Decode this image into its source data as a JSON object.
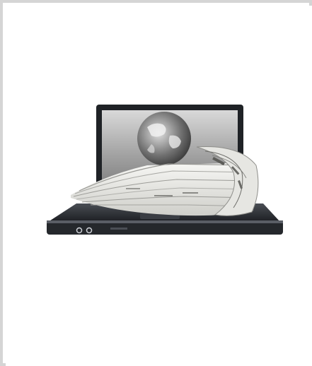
{
  "image": {
    "subject": "laptop-with-newspapers",
    "background_color": "#ffffff",
    "frame_color": "#d5d5d5",
    "screen_color": "#8a8a8a",
    "laptop_body_color": "#2b2e33",
    "paper_color": "#eeeeea"
  }
}
